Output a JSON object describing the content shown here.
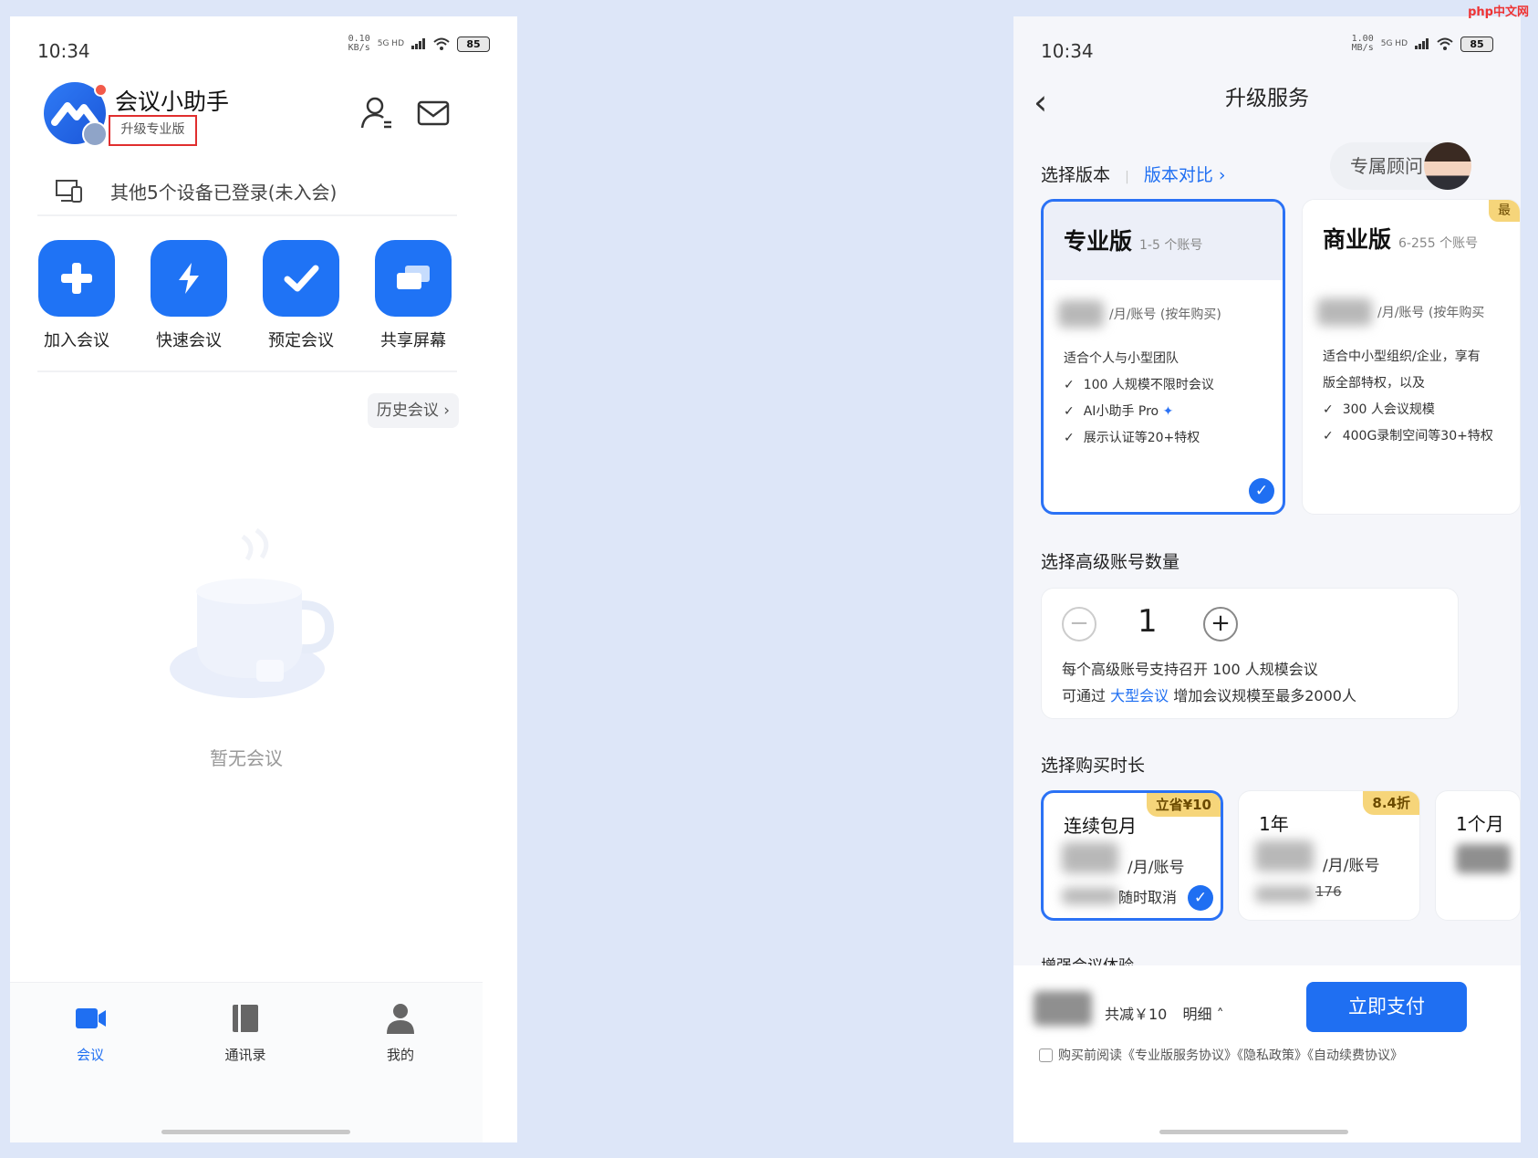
{
  "left": {
    "status_time": "10:34",
    "status_speed": "0.10\nKB/s",
    "status_net": "5G HD",
    "battery": "85",
    "app_title": "会议小助手",
    "upgrade_tag": "升级专业版",
    "device_text": "其他5个设备已登录(未入会)",
    "actions": [
      {
        "label": "加入会议",
        "icon": "plus-icon"
      },
      {
        "label": "快速会议",
        "icon": "lightning-icon"
      },
      {
        "label": "预定会议",
        "icon": "check-icon"
      },
      {
        "label": "共享屏幕",
        "icon": "screens-icon"
      }
    ],
    "history_label": "历史会议",
    "empty_text": "暂无会议",
    "tabs": [
      {
        "label": "会议",
        "icon": "video-icon",
        "active": true
      },
      {
        "label": "通讯录",
        "icon": "book-icon",
        "active": false
      },
      {
        "label": "我的",
        "icon": "person-icon",
        "active": false
      }
    ]
  },
  "right": {
    "status_time": "10:34",
    "status_speed": "1.00\nMB/s",
    "status_net": "5G HD",
    "battery": "85",
    "title": "升级服务",
    "select_version": "选择版本",
    "compare": "版本对比",
    "consultant": "专属顾问",
    "plans": [
      {
        "name": "专业版",
        "range": "1-5 个账号",
        "price_unit": "/月/账号 (按年购买)",
        "desc": "适合个人与小型团队",
        "features": [
          "100 人规模不限时会议",
          "AI小助手 Pro",
          "展示认证等20+特权"
        ]
      },
      {
        "name": "商业版",
        "range": "6-255 个账号",
        "price_unit": "/月/账号 (按年购买",
        "tag": "最",
        "desc_lines": [
          "适合中小型组织/企业，享有",
          "版全部特权，以及"
        ],
        "features": [
          "300 人会议规模",
          "400G录制空间等30+特权"
        ]
      }
    ],
    "qty_section": "选择高级账号数量",
    "qty_value": "1",
    "qty_minus": "−",
    "qty_plus": "+",
    "qty_info": "每个高级账号支持召开 100 人规模会议",
    "qty_info2_pre": "可通过",
    "qty_info2_link": "大型会议",
    "qty_info2_post": "增加会议规模至最多2000人",
    "duration_section": "选择购买时长",
    "durations": [
      {
        "name": "连续包月",
        "tag": "立省¥10",
        "unit": "/月/账号",
        "note": "随时取消"
      },
      {
        "name": "1年",
        "tag": "8.4折",
        "unit": "/月/账号",
        "note": "176"
      },
      {
        "name": "1个月",
        "tag": ""
      }
    ],
    "enhance_section": "增强会议体验",
    "discount": "共减￥10",
    "detail": "明细",
    "pay": "立即支付",
    "agreement": "购买前阅读《专业版服务协议》《隐私政策》《自动续费协议》"
  },
  "watermark": "php中文网",
  "colors": {
    "accent": "#1f6ff2",
    "tag": "#f6d57a",
    "highlight": "#e02e2e"
  }
}
